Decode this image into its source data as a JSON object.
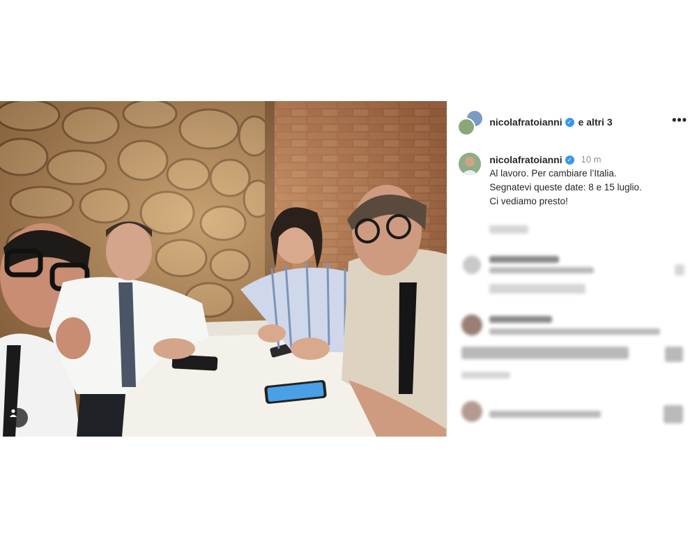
{
  "header": {
    "username": "nicolafratoianni",
    "coauthors": "e altri 3",
    "more_icon": "more-horizontal-icon"
  },
  "caption": {
    "username": "nicolafratoianni",
    "time": "10 m",
    "lines": [
      "Al lavoro. Per cambiare l’Italia.",
      "Segnatevi queste date: 8 e 15 luglio.",
      "Ci vediamo presto!"
    ]
  },
  "photo": {
    "tag_icon": "user-tag-icon"
  },
  "colors": {
    "verified": "#3897f0",
    "text": "#262626",
    "muted": "#8e8e8e"
  }
}
